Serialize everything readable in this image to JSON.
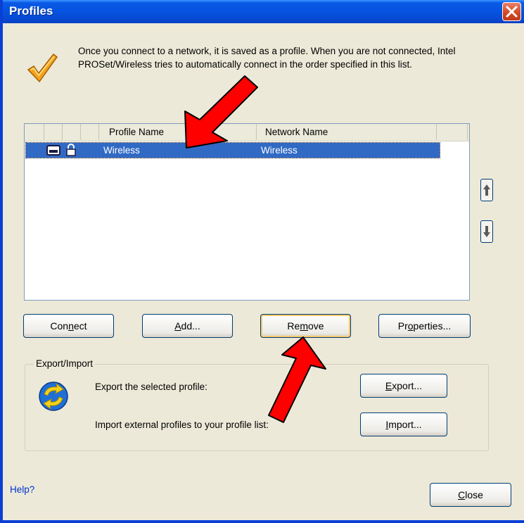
{
  "window": {
    "title": "Profiles",
    "close_icon": "close-icon"
  },
  "info": {
    "icon": "checkmark-icon",
    "text": "Once you connect to a network, it is saved as a profile. When you are not connected, Intel PROSet/Wireless tries to automatically connect in the order specified in this list."
  },
  "profile_list": {
    "columns": [
      "",
      "",
      "",
      "Profile Name",
      "Network Name",
      ""
    ],
    "rows": [
      {
        "profile_name": "Wireless",
        "network_name": "Wireless",
        "icons": [
          "adapter-icon",
          "lock-icon"
        ],
        "selected": true
      }
    ]
  },
  "side_buttons": {
    "up": "arrow-up-icon",
    "down": "arrow-down-icon"
  },
  "buttons": {
    "connect": {
      "pre": "Con",
      "ul": "n",
      "post": "ect"
    },
    "add": {
      "pre": "",
      "ul": "A",
      "post": "dd..."
    },
    "remove": {
      "pre": "Re",
      "ul": "m",
      "post": "ove"
    },
    "properties": {
      "pre": "Pr",
      "ul": "o",
      "post": "perties..."
    },
    "export": {
      "pre": "",
      "ul": "E",
      "post": "xport..."
    },
    "import": {
      "pre": "",
      "ul": "I",
      "post": "mport..."
    },
    "close": {
      "pre": "",
      "ul": "C",
      "post": "lose"
    }
  },
  "export_import": {
    "group_label": "Export/Import",
    "icon": "sync-arrows-icon",
    "export_text": "Export the selected profile:",
    "import_text": "Import external profiles to your profile list:"
  },
  "help": {
    "label": "Help?"
  },
  "colors": {
    "title_bar": "#0553e0",
    "selection": "#316ac5",
    "close_button": "#d3461f",
    "annotation_arrow": "#ff0000"
  }
}
